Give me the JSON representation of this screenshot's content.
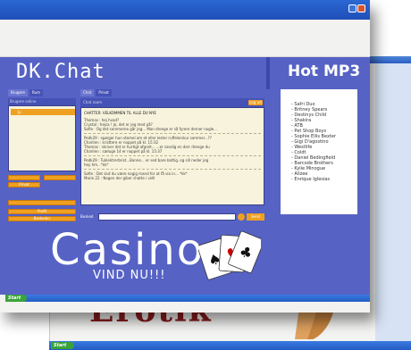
{
  "site": {
    "logo": "DK.Chat",
    "right_heading": "Hot MP3"
  },
  "user_panel": {
    "tabs": [
      "Brugere",
      "Rum"
    ],
    "list_header": "Brugere online",
    "users": [
      "Ju"
    ],
    "buttons": [
      "",
      "",
      "Privat",
      "",
      "Profil",
      "Beskeder"
    ]
  },
  "chat": {
    "tabs": [
      "Chat",
      "Privat"
    ],
    "room_label": "Chat room",
    "logout_label": "Log ud",
    "header_message": "CHATTER: VELKOMMEN TIL ALLE DU NYE",
    "message_groups": [
      [
        "Thomas : hej hvad?",
        "Crystal : hejsa ! Jo, det er jeg med på?",
        "Sofie : Og det sommerne går jeg... Mon drenge er så fyrere derner nogle..."
      ],
      [
        "Pedk29 : spørger hun stemel om et eller lester ruffelerskur sommer...??",
        "Charlien : kristtere er noppet på kl. 15:32",
        "Thomas : skriver det er hurtigt afgreit... ...er sandig en derr drenge du",
        "Charlien : sæluge 14 er noppet på kl. 15:37"
      ],
      [
        "Pedk29 : Tuklektrerbrist...Banne... er sed bare battig, og sill neder jeg",
        "hey hm.. *kk*"
      ],
      [
        "Sofie : Det slut du være nogig mand for at få via in... *kk*",
        "Marie 22 : Nogen der giber chatte i vidt"
      ]
    ],
    "input_label": "Besked",
    "send_label": "Send"
  },
  "mp3_list": [
    "Safri Duo",
    "Britney Spears",
    "Destinys Child",
    "Shakira",
    "ATB",
    "Pet Shop Boys",
    "Sophie Ellis Bexter",
    "Gigi D'agostino",
    "Westlife",
    "Coldt",
    "Daniel Bedingfield",
    "Barcode Brothers",
    "Kylie Minogue",
    "Allzee",
    "Enrique Iglesias"
  ],
  "casino": {
    "title": "Casino",
    "subtitle": "VIND NU!!!"
  },
  "background_window": {
    "text": "Erotik"
  },
  "taskbar": {
    "start_label": "Start"
  }
}
